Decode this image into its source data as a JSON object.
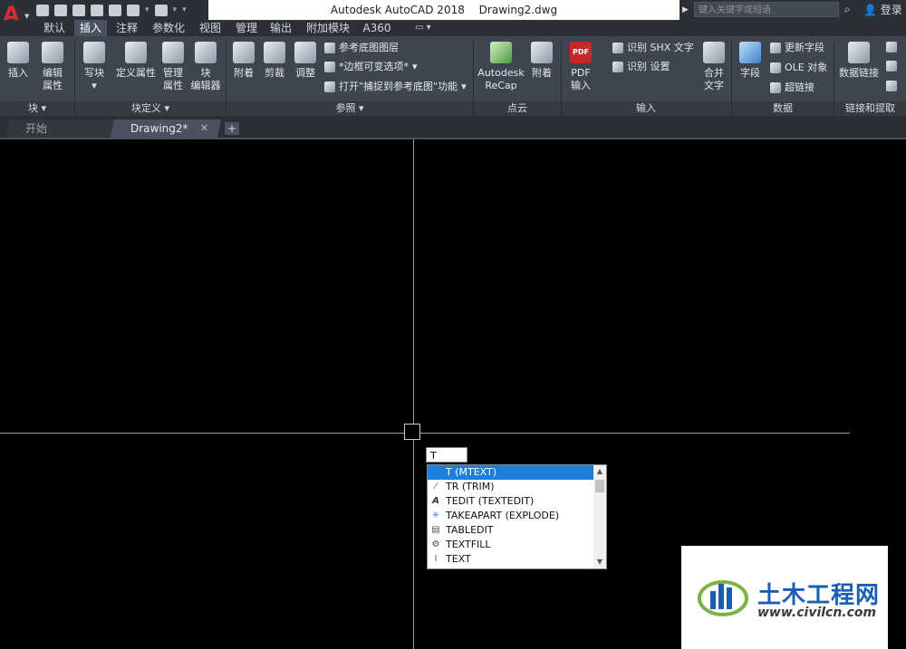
{
  "window": {
    "title_app": "Autodesk AutoCAD 2018",
    "title_doc": "Drawing2.dwg",
    "search_placeholder": "键入关键字或短语",
    "signin": "登录"
  },
  "ribbon_tabs": [
    {
      "label": "默认",
      "active": false
    },
    {
      "label": "插入",
      "active": true
    },
    {
      "label": "注释",
      "active": false
    },
    {
      "label": "参数化",
      "active": false
    },
    {
      "label": "视图",
      "active": false
    },
    {
      "label": "管理",
      "active": false
    },
    {
      "label": "输出",
      "active": false
    },
    {
      "label": "附加模块",
      "active": false
    },
    {
      "label": "A360",
      "active": false
    }
  ],
  "ribbon": {
    "block": {
      "title": "块",
      "insert": "插入",
      "edit_attr_1": "编辑",
      "edit_attr_2": "属性"
    },
    "block_def": {
      "title": "块定义",
      "write_block": "写块",
      "define_attr": "定义属性",
      "manage_attr_1": "管理",
      "manage_attr_2": "属性",
      "block_editor_1": "块",
      "block_editor_2": "编辑器"
    },
    "reference": {
      "title": "参照",
      "attach": "附着",
      "clip": "剪裁",
      "adjust": "调整",
      "underlay_layers": "参考底图图层",
      "frame_var": "*边框可变选项*",
      "snap_underlay": "打开\"捕捉到参考底图\"功能"
    },
    "point_cloud": {
      "title": "点云",
      "recap_1": "Autodesk",
      "recap_2": "ReCap",
      "attach": "附着"
    },
    "import": {
      "title": "输入",
      "pdf_1": "PDF",
      "pdf_2": "输入",
      "pdf_icon": "PDF",
      "recognize_shx": "识别 SHX 文字",
      "recognize_settings": "识别 设置",
      "combine_1": "合并",
      "combine_2": "文字"
    },
    "data": {
      "title": "数据",
      "field": "字段",
      "update_fields": "更新字段",
      "ole_object": "OLE 对象",
      "hyperlink": "超链接"
    },
    "linking": {
      "title": "链接和提取",
      "data_link": "数据链接"
    }
  },
  "doc_tabs": [
    {
      "label": "开始",
      "active": false
    },
    {
      "label": "Drawing2*",
      "active": true
    }
  ],
  "command": {
    "input_value": "T",
    "suggestions": [
      {
        "label": "T (MTEXT)",
        "selected": true,
        "icon": "mtext-icon"
      },
      {
        "label": "TR (TRIM)",
        "selected": false,
        "icon": "trim-icon"
      },
      {
        "label": "TEDIT (TEXTEDIT)",
        "selected": false,
        "icon": "textedit-icon"
      },
      {
        "label": "TAKEAPART (EXPLODE)",
        "selected": false,
        "icon": "explode-icon"
      },
      {
        "label": "TABLEDIT",
        "selected": false,
        "icon": "tabledit-icon"
      },
      {
        "label": "TEXTFILL",
        "selected": false,
        "icon": "gear-icon"
      },
      {
        "label": "TEXT",
        "selected": false,
        "icon": "text-cursor-icon"
      }
    ]
  },
  "watermark": {
    "cn": "土木工程网",
    "url": "www.civilcn.com"
  },
  "colors": {
    "accent": "#1e7fd8",
    "ribbon_bg": "#3f4550",
    "title_bg": "#2b2f36"
  }
}
